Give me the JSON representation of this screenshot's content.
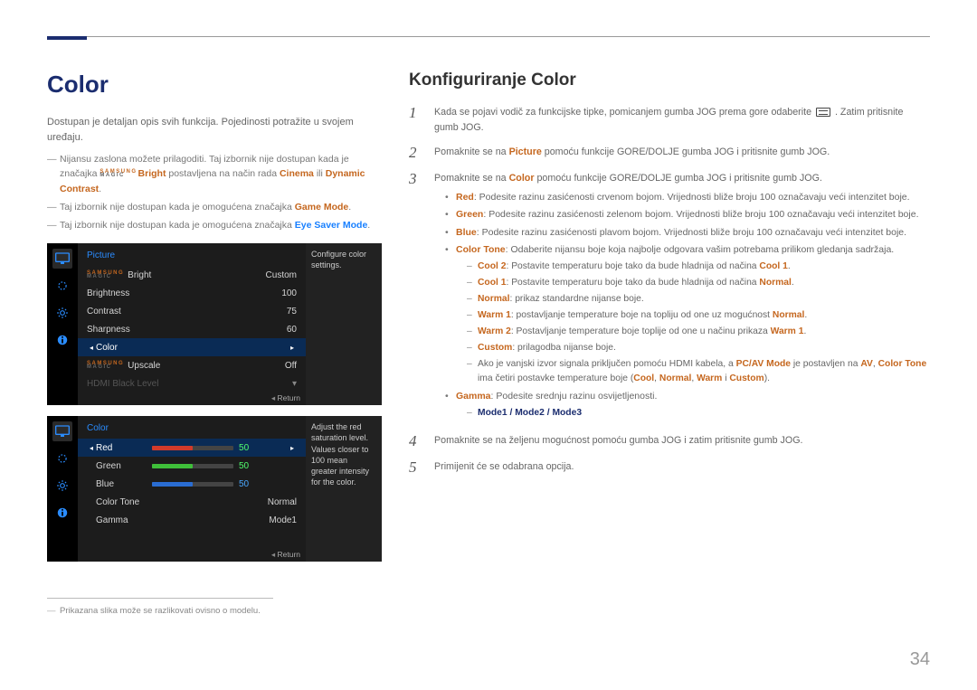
{
  "page_number": "34",
  "left": {
    "heading": "Color",
    "intro": "Dostupan je detaljan opis svih funkcija. Pojedinosti potražite u svojem uređaju.",
    "notes": {
      "n1_a": "Nijansu zaslona možete prilagoditi. Taj izbornik nije dostupan kada je značajka ",
      "n1_bright": "Bright",
      "n1_b": " postavljena na način rada ",
      "n1_c": "Cinema",
      "n1_d": " ili ",
      "n1_e": "Dynamic Contrast",
      "n1_f": ".",
      "n2_a": "Taj izbornik nije dostupan kada je omogućena značajka ",
      "n2_b": "Game Mode",
      "n2_c": ".",
      "n3_a": "Taj izbornik nije dostupan kada je omogućena značajka ",
      "n3_b": "Eye Saver Mode",
      "n3_c": "."
    },
    "footnote": "Prikazana slika može se razlikovati ovisno o modelu."
  },
  "osd1": {
    "title": "Picture",
    "tip": "Configure color settings.",
    "footer": "Return",
    "rows": {
      "r0_label": "Bright",
      "r0_value": "Custom",
      "r1_label": "Brightness",
      "r1_value": "100",
      "r2_label": "Contrast",
      "r2_value": "75",
      "r3_label": "Sharpness",
      "r3_value": "60",
      "r4_label": "Color",
      "r5_label": "Upscale",
      "r5_value": "Off",
      "r6_label": "HDMI Black Level"
    }
  },
  "osd2": {
    "title": "Color",
    "tip": "Adjust the red saturation level. Values closer to 100 mean greater intensity for the color.",
    "footer": "Return",
    "rows": {
      "r0_label": "Red",
      "r0_value": "50",
      "r1_label": "Green",
      "r1_value": "50",
      "r2_label": "Blue",
      "r2_value": "50",
      "r3_label": "Color Tone",
      "r3_value": "Normal",
      "r4_label": "Gamma",
      "r4_value": "Mode1"
    }
  },
  "right": {
    "heading": "Konfiguriranje Color",
    "step1_a": "Kada se pojavi vodič za funkcijske tipke, pomicanjem gumba JOG prema gore odaberite ",
    "step1_b": ". Zatim pritisnite gumb JOG.",
    "step2_a": "Pomaknite se na ",
    "step2_b": "Picture",
    "step2_c": " pomoću funkcije GORE/DOLJE gumba JOG i pritisnite gumb JOG.",
    "step3_a": "Pomaknite se na ",
    "step3_b": "Color",
    "step3_c": " pomoću funkcije GORE/DOLJE gumba JOG i pritisnite gumb JOG.",
    "bullets": {
      "red_a": "Red",
      "red_b": ": Podesite razinu zasićenosti crvenom bojom. Vrijednosti bliže broju 100 označavaju veći intenzitet boje.",
      "green_a": "Green",
      "green_b": ": Podesite razinu zasićenosti zelenom bojom. Vrijednosti bliže broju 100 označavaju veći intenzitet boje.",
      "blue_a": "Blue",
      "blue_b": ": Podesite razinu zasićenosti plavom bojom. Vrijednosti bliže broju 100 označavaju veći intenzitet boje.",
      "ct_a": "Color Tone",
      "ct_b": ": Odaberite nijansu boje koja najbolje odgovara vašim potrebama prilikom gledanja sadržaja.",
      "ct1_a": "Cool 2",
      "ct1_b": ": Postavite temperaturu boje tako da bude hladnija od načina ",
      "ct1_c": "Cool 1",
      "ct1_d": ".",
      "ct2_a": "Cool 1",
      "ct2_b": ": Postavite temperaturu boje tako da bude hladnija od načina ",
      "ct2_c": "Normal",
      "ct2_d": ".",
      "ct3_a": "Normal",
      "ct3_b": ": prikaz standardne nijanse boje.",
      "ct4_a": "Warm 1",
      "ct4_b": ": postavljanje temperature boje na topliju od one uz mogućnost ",
      "ct4_c": "Normal",
      "ct4_d": ".",
      "ct5_a": "Warm 2",
      "ct5_b": ": Postavljanje temperature boje toplije od one u načinu prikaza ",
      "ct5_c": "Warm 1",
      "ct5_d": ".",
      "ct6_a": "Custom",
      "ct6_b": ": prilagodba nijanse boje.",
      "pcav_a": "Ako je vanjski izvor signala priključen pomoću HDMI kabela, a ",
      "pcav_b": "PC/AV Mode",
      "pcav_c": " je postavljen na ",
      "pcav_d": "AV",
      "pcav_e": ", ",
      "pcav_f": "Color Tone",
      "pcav_g": " ima četiri postavke temperature boje (",
      "pcav_h": "Cool",
      "pcav_i": ", ",
      "pcav_j": "Normal",
      "pcav_k": ", ",
      "pcav_l": "Warm",
      "pcav_m": " i ",
      "pcav_n": "Custom",
      "pcav_o": ").",
      "gamma_a": "Gamma",
      "gamma_b": ": Podesite srednju razinu osvijetljenosti.",
      "gm_a": "Mode1",
      "gm_b": " / ",
      "gm_c": "Mode2",
      "gm_d": " / ",
      "gm_e": "Mode3"
    },
    "step4": "Pomaknite se na željenu mogućnost pomoću gumba JOG i zatim pritisnite gumb JOG.",
    "step5": "Primijenit će se odabrana opcija."
  },
  "magic": {
    "samsung": "SAMSUNG",
    "magic": "MAGIC"
  }
}
